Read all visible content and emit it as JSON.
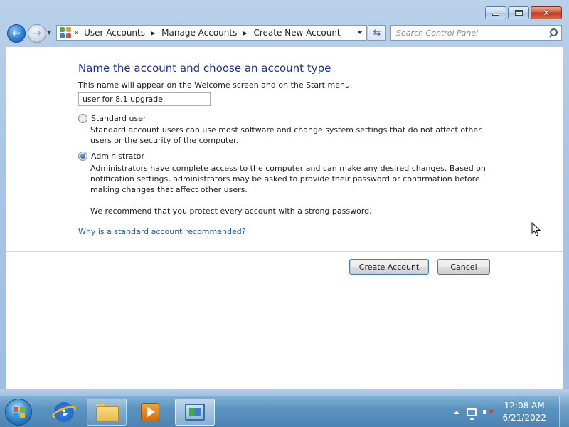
{
  "window": {
    "controls": {
      "minimize": "minimize",
      "maximize": "maximize",
      "close": "close"
    }
  },
  "nav": {
    "breadcrumb_overflow": "«",
    "breadcrumbs": [
      "User Accounts",
      "Manage Accounts",
      "Create New Account"
    ],
    "search_placeholder": "Search Control Panel"
  },
  "page": {
    "heading": "Name the account and choose an account type",
    "hint": "This name will appear on the Welcome screen and on the Start menu.",
    "account_name_value": "user for 8.1 upgrade",
    "options": [
      {
        "label": "Standard user",
        "description": "Standard account users can use most software and change system settings that do not affect other users or the security of the computer.",
        "checked": false
      },
      {
        "label": "Administrator",
        "description": "Administrators have complete access to the computer and can make any desired changes. Based on notification settings, administrators may be asked to provide their password or confirmation before making changes that affect other users.",
        "recommend": "We recommend that you protect every account with a strong password.",
        "checked": true
      }
    ],
    "link": "Why is a standard account recommended?",
    "buttons": {
      "create": "Create Account",
      "cancel": "Cancel"
    }
  },
  "taskbar": {
    "pinned": [
      "internet-explorer",
      "windows-explorer",
      "windows-media-player",
      "control-panel"
    ],
    "clock_time": "12:08 AM",
    "clock_date": "6/21/2022"
  }
}
